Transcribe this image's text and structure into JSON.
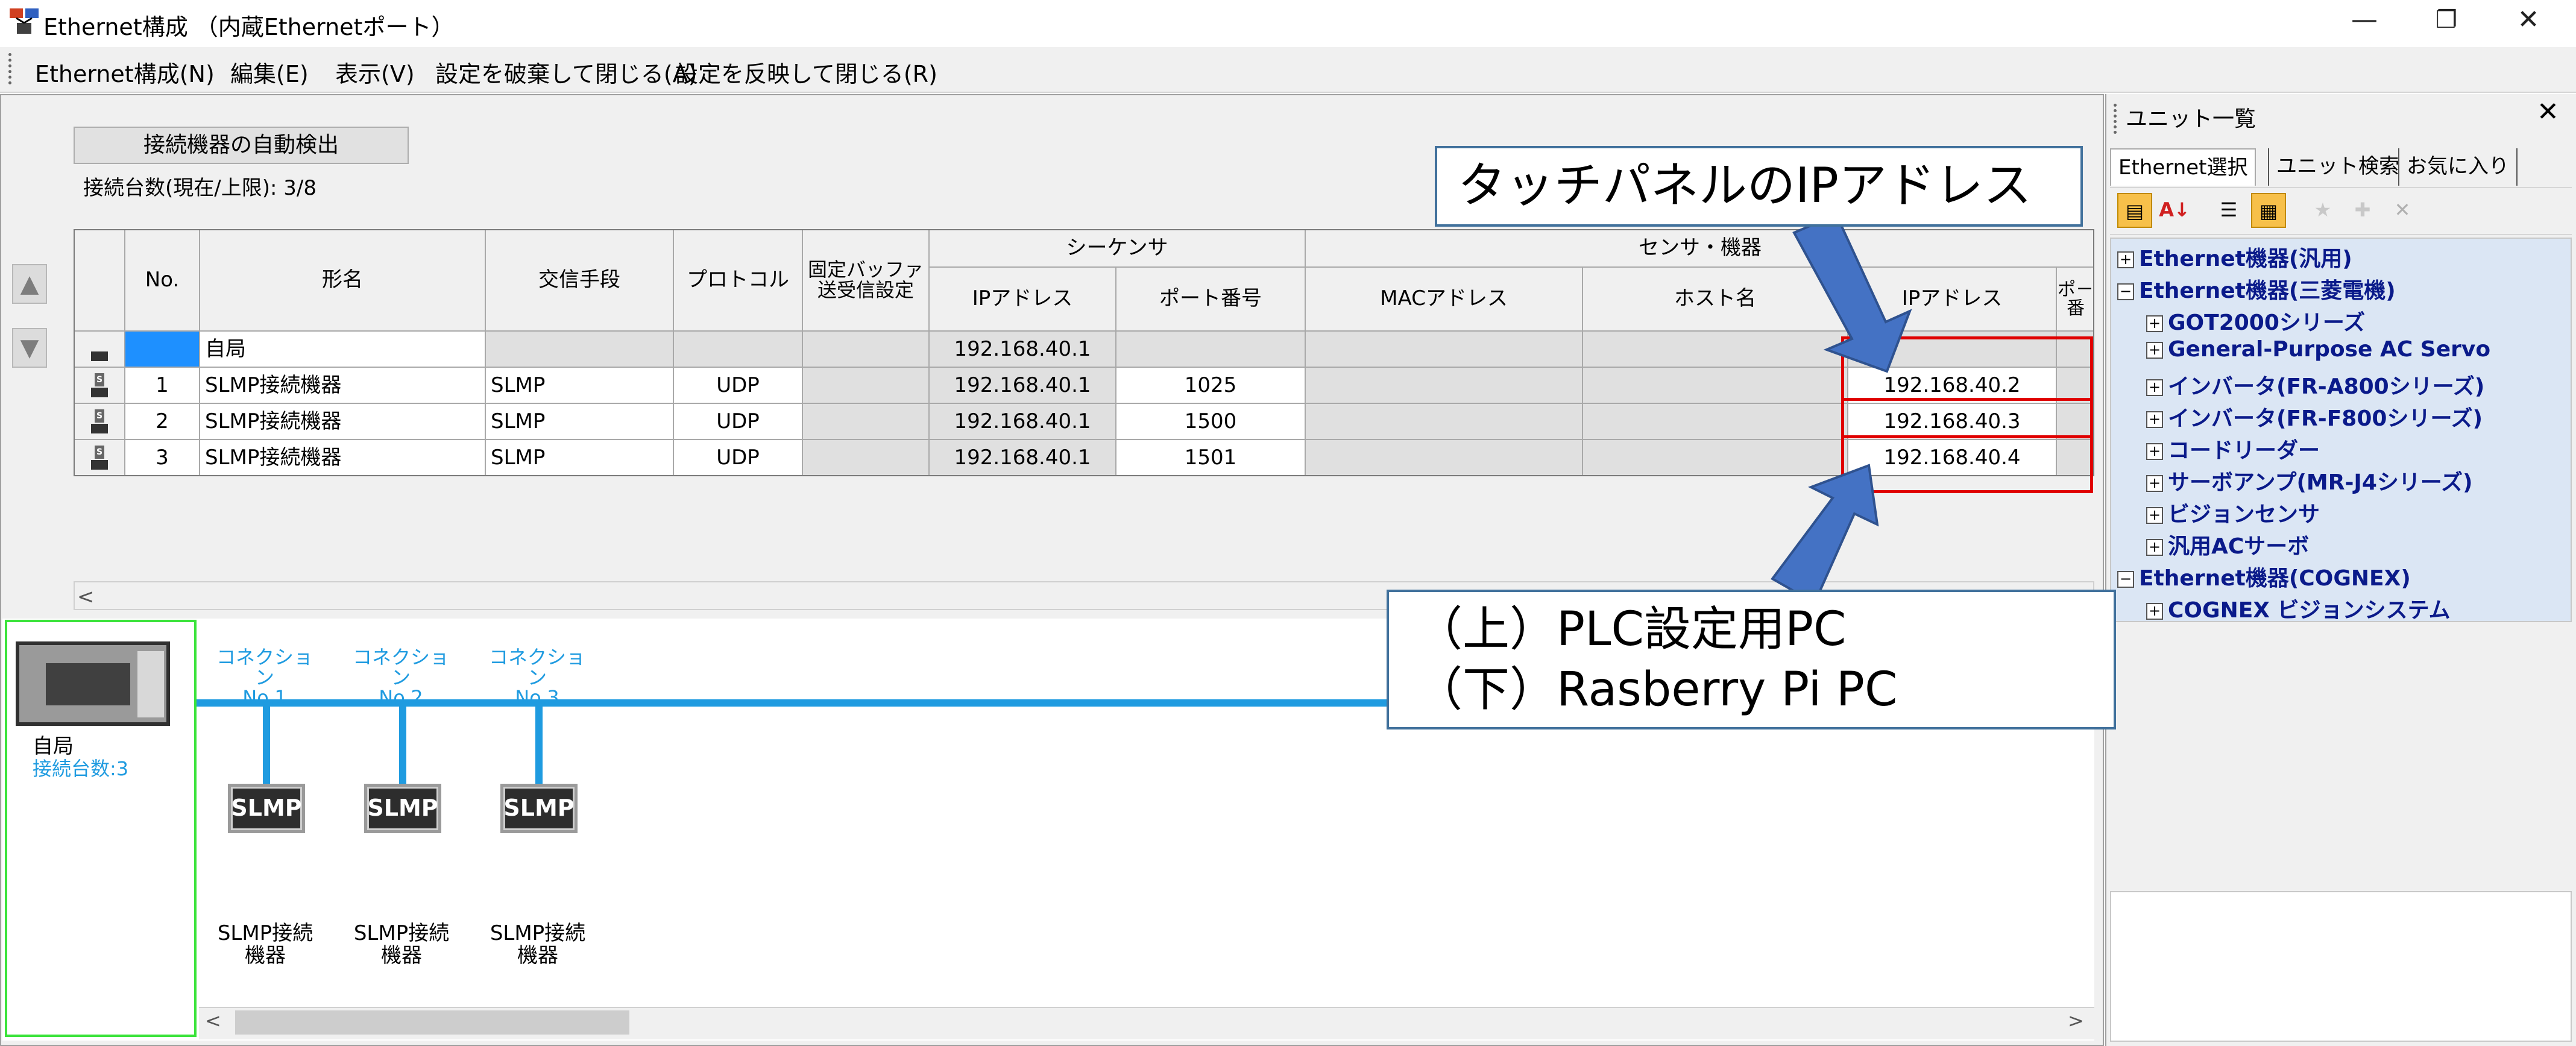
{
  "window": {
    "title": "Ethernet構成 （内蔵Ethernetポート）",
    "minimize": "—",
    "restore": "❐",
    "close": "✕"
  },
  "menu": [
    "Ethernet構成(N)",
    "編集(E)",
    "表示(V)",
    "設定を破棄して閉じる(A)",
    "設定を反映して閉じる(R)"
  ],
  "toolbar": {
    "auto_detect_label": "接続機器の自動検出",
    "connection_count": "接続台数(現在/上限): 3/8"
  },
  "table": {
    "group_headers": {
      "sequencer": "シーケンサ",
      "sensor": "センサ・機器"
    },
    "headers": {
      "no": "No.",
      "model": "形名",
      "comm": "交信手段",
      "protocol": "プロトコル",
      "fixed_buffer": "固定バッファ送受信設定",
      "seq_ip": "IPアドレス",
      "seq_port": "ポート番号",
      "mac": "MACアドレス",
      "host": "ホスト名",
      "dev_ip": "IPアドレス",
      "dev_port": "ポ－番"
    },
    "rows": [
      {
        "no": "",
        "model": "自局",
        "comm": "",
        "protocol": "",
        "fixed": "",
        "seq_ip": "192.168.40.1",
        "seq_port": "",
        "mac": "",
        "host": "",
        "dev_ip": "",
        "dev_port": ""
      },
      {
        "no": "1",
        "model": "SLMP接続機器",
        "comm": "SLMP",
        "protocol": "UDP",
        "fixed": "",
        "seq_ip": "192.168.40.1",
        "seq_port": "1025",
        "mac": "",
        "host": "",
        "dev_ip": "192.168.40.2",
        "dev_port": ""
      },
      {
        "no": "2",
        "model": "SLMP接続機器",
        "comm": "SLMP",
        "protocol": "UDP",
        "fixed": "",
        "seq_ip": "192.168.40.1",
        "seq_port": "1500",
        "mac": "",
        "host": "",
        "dev_ip": "192.168.40.3",
        "dev_port": ""
      },
      {
        "no": "3",
        "model": "SLMP接続機器",
        "comm": "SLMP",
        "protocol": "UDP",
        "fixed": "",
        "seq_ip": "192.168.40.1",
        "seq_port": "1501",
        "mac": "",
        "host": "",
        "dev_ip": "192.168.40.4",
        "dev_port": ""
      }
    ]
  },
  "network": {
    "self_label": "自局",
    "self_count": "接続台数:3",
    "connections": [
      {
        "label": "コネクション No.1",
        "box": "SLMP",
        "device": "SLMP接続 機器"
      },
      {
        "label": "コネクション No.2",
        "box": "SLMP",
        "device": "SLMP接続 機器"
      },
      {
        "label": "コネクション No.3",
        "box": "SLMP",
        "device": "SLMP接続 機器"
      }
    ]
  },
  "callouts": {
    "touch_panel": "タッチパネルのIPアドレス",
    "pc_line1": "（上）PLC設定用PC",
    "pc_line2": "（下）Rasberry Pi PC"
  },
  "unit_panel": {
    "title": "ユニット一覧",
    "close": "✕",
    "tabs": [
      "Ethernet選択",
      "ユニット検索",
      "お気に入り"
    ],
    "tree": [
      {
        "label": "Ethernet機器(汎用)",
        "level": 0,
        "sign": "⊞"
      },
      {
        "label": "Ethernet機器(三菱電機)",
        "level": 0,
        "sign": "⊟"
      },
      {
        "label": "GOT2000シリーズ",
        "level": 1,
        "sign": "⊞"
      },
      {
        "label": "General-Purpose AC Servo",
        "level": 1,
        "sign": "⊞"
      },
      {
        "label": "インバータ(FR-A800シリーズ)",
        "level": 1,
        "sign": "⊞"
      },
      {
        "label": "インバータ(FR-F800シリーズ)",
        "level": 1,
        "sign": "⊞"
      },
      {
        "label": "コードリーダー",
        "level": 1,
        "sign": "⊞"
      },
      {
        "label": "サーボアンプ(MR-J4シリーズ)",
        "level": 1,
        "sign": "⊞"
      },
      {
        "label": "ビジョンセンサ",
        "level": 1,
        "sign": "⊞"
      },
      {
        "label": "汎用ACサーボ",
        "level": 1,
        "sign": "⊞"
      },
      {
        "label": "Ethernet機器(COGNEX)",
        "level": 0,
        "sign": "⊟"
      },
      {
        "label": "COGNEX ビジョンシステム",
        "level": 1,
        "sign": "⊞"
      }
    ]
  },
  "colors": {
    "accent": "#1f9be0",
    "highlight": "#e00000",
    "callout_border": "#41719c",
    "arrow": "#4472c4",
    "self_frame": "#3be33b"
  }
}
